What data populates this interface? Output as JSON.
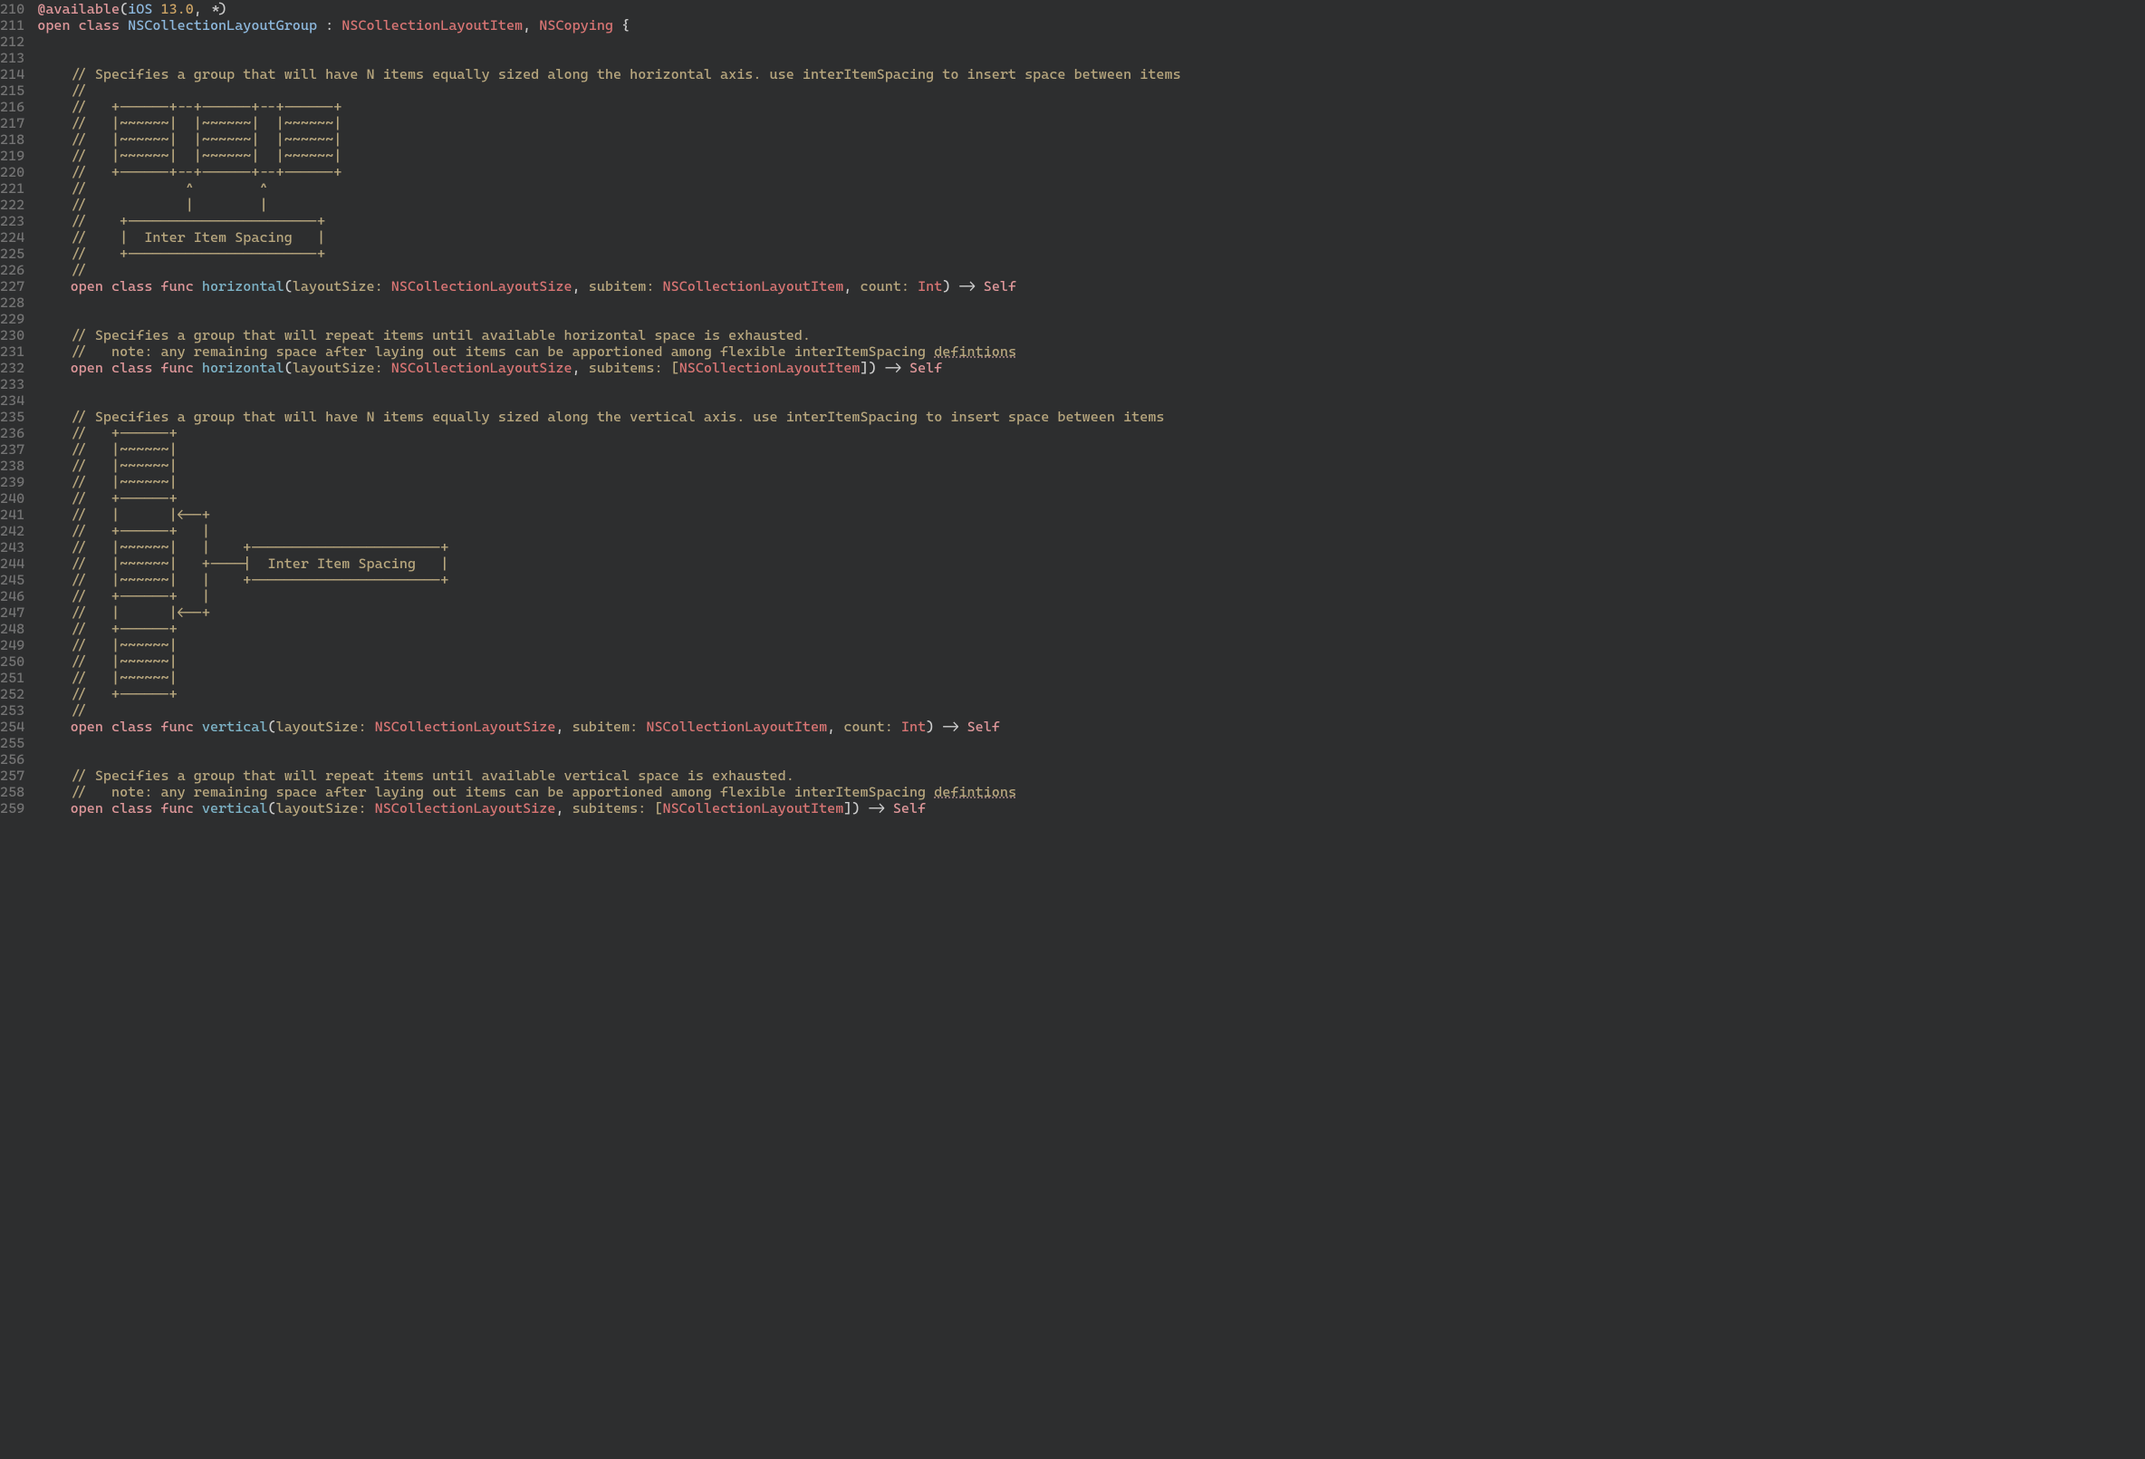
{
  "startLine": 210,
  "lines": [
    {
      "tokens": [
        {
          "t": "@available",
          "c": "kw-attr"
        },
        {
          "t": "(",
          "c": "punct"
        },
        {
          "t": "iOS",
          "c": "type"
        },
        {
          "t": " ",
          "c": "punct"
        },
        {
          "t": "13.0",
          "c": "num"
        },
        {
          "t": ", ",
          "c": "punct"
        },
        {
          "t": "*",
          "c": "star"
        },
        {
          "t": ")",
          "c": "punct"
        }
      ]
    },
    {
      "tokens": [
        {
          "t": "open class ",
          "c": "kw"
        },
        {
          "t": "NSCollectionLayoutGroup",
          "c": "type"
        },
        {
          "t": " : ",
          "c": "punct"
        },
        {
          "t": "NSCollectionLayoutItem",
          "c": "type-red"
        },
        {
          "t": ", ",
          "c": "punct"
        },
        {
          "t": "NSCopying",
          "c": "type-red"
        },
        {
          "t": " {",
          "c": "punct"
        }
      ]
    },
    {
      "tokens": []
    },
    {
      "tokens": [
        {
          "t": "    ",
          "c": ""
        }
      ]
    },
    {
      "tokens": [
        {
          "t": "    // Specifies a group that will have N items equally sized along the horizontal axis. use interItemSpacing to insert space between items",
          "c": "comment"
        }
      ]
    },
    {
      "tokens": [
        {
          "t": "    //",
          "c": "comment"
        }
      ]
    },
    {
      "tokens": [
        {
          "t": "    //   +------+--+------+--+------+",
          "c": "comment"
        }
      ]
    },
    {
      "tokens": [
        {
          "t": "    //   |~~~~~~|  |~~~~~~|  |~~~~~~|",
          "c": "comment"
        }
      ]
    },
    {
      "tokens": [
        {
          "t": "    //   |~~~~~~|  |~~~~~~|  |~~~~~~|",
          "c": "comment"
        }
      ]
    },
    {
      "tokens": [
        {
          "t": "    //   |~~~~~~|  |~~~~~~|  |~~~~~~|",
          "c": "comment"
        }
      ]
    },
    {
      "tokens": [
        {
          "t": "    //   +------+--+------+--+------+",
          "c": "comment"
        }
      ]
    },
    {
      "tokens": [
        {
          "t": "    //            ^        ^",
          "c": "comment"
        }
      ]
    },
    {
      "tokens": [
        {
          "t": "    //            |        |",
          "c": "comment"
        }
      ]
    },
    {
      "tokens": [
        {
          "t": "    //    +-----------------------+",
          "c": "comment"
        }
      ]
    },
    {
      "tokens": [
        {
          "t": "    //    |  Inter Item Spacing   |",
          "c": "comment"
        }
      ]
    },
    {
      "tokens": [
        {
          "t": "    //    +-----------------------+",
          "c": "comment"
        }
      ]
    },
    {
      "tokens": [
        {
          "t": "    //",
          "c": "comment"
        }
      ]
    },
    {
      "tokens": [
        {
          "t": "    ",
          "c": ""
        },
        {
          "t": "open class func ",
          "c": "kw"
        },
        {
          "t": "horizontal",
          "c": "func-name"
        },
        {
          "t": "(",
          "c": "punct"
        },
        {
          "t": "layoutSize: ",
          "c": "param"
        },
        {
          "t": "NSCollectionLayoutSize",
          "c": "type-red"
        },
        {
          "t": ", ",
          "c": "punct"
        },
        {
          "t": "subitem: ",
          "c": "param"
        },
        {
          "t": "NSCollectionLayoutItem",
          "c": "type-red"
        },
        {
          "t": ", ",
          "c": "punct"
        },
        {
          "t": "count: ",
          "c": "param"
        },
        {
          "t": "Int",
          "c": "type-int"
        },
        {
          "t": ") -> ",
          "c": "punct"
        },
        {
          "t": "Self",
          "c": "self-kw"
        }
      ]
    },
    {
      "tokens": []
    },
    {
      "tokens": [
        {
          "t": "    ",
          "c": ""
        }
      ]
    },
    {
      "tokens": [
        {
          "t": "    // Specifies a group that will repeat items until available horizontal space is exhausted.",
          "c": "comment"
        }
      ]
    },
    {
      "tokens": [
        {
          "t": "    //   note: any remaining space after laying out items can be apportioned among flexible interItemSpacing ",
          "c": "comment"
        },
        {
          "t": "defintions",
          "c": "comment underline-wavy"
        }
      ]
    },
    {
      "tokens": [
        {
          "t": "    ",
          "c": ""
        },
        {
          "t": "open class func ",
          "c": "kw"
        },
        {
          "t": "horizontal",
          "c": "func-name"
        },
        {
          "t": "(",
          "c": "punct"
        },
        {
          "t": "layoutSize: ",
          "c": "param"
        },
        {
          "t": "NSCollectionLayoutSize",
          "c": "type-red"
        },
        {
          "t": ", ",
          "c": "punct"
        },
        {
          "t": "subitems: [",
          "c": "param"
        },
        {
          "t": "NSCollectionLayoutItem",
          "c": "type-red"
        },
        {
          "t": "]) -> ",
          "c": "punct"
        },
        {
          "t": "Self",
          "c": "self-kw"
        }
      ]
    },
    {
      "tokens": []
    },
    {
      "tokens": [
        {
          "t": "    ",
          "c": ""
        }
      ]
    },
    {
      "tokens": [
        {
          "t": "    // Specifies a group that will have N items equally sized along the vertical axis. use interItemSpacing to insert space between items",
          "c": "comment"
        }
      ]
    },
    {
      "tokens": [
        {
          "t": "    //   +------+",
          "c": "comment"
        }
      ]
    },
    {
      "tokens": [
        {
          "t": "    //   |~~~~~~|",
          "c": "comment"
        }
      ]
    },
    {
      "tokens": [
        {
          "t": "    //   |~~~~~~|",
          "c": "comment"
        }
      ]
    },
    {
      "tokens": [
        {
          "t": "    //   |~~~~~~|",
          "c": "comment"
        }
      ]
    },
    {
      "tokens": [
        {
          "t": "    //   +------+",
          "c": "comment"
        }
      ]
    },
    {
      "tokens": [
        {
          "t": "    //   |      |<--+",
          "c": "comment"
        }
      ]
    },
    {
      "tokens": [
        {
          "t": "    //   +------+   |",
          "c": "comment"
        }
      ]
    },
    {
      "tokens": [
        {
          "t": "    //   |~~~~~~|   |    +-----------------------+",
          "c": "comment"
        }
      ]
    },
    {
      "tokens": [
        {
          "t": "    //   |~~~~~~|   +----|  Inter Item Spacing   |",
          "c": "comment"
        }
      ]
    },
    {
      "tokens": [
        {
          "t": "    //   |~~~~~~|   |    +-----------------------+",
          "c": "comment"
        }
      ]
    },
    {
      "tokens": [
        {
          "t": "    //   +------+   |",
          "c": "comment"
        }
      ]
    },
    {
      "tokens": [
        {
          "t": "    //   |      |<--+",
          "c": "comment"
        }
      ]
    },
    {
      "tokens": [
        {
          "t": "    //   +------+",
          "c": "comment"
        }
      ]
    },
    {
      "tokens": [
        {
          "t": "    //   |~~~~~~|",
          "c": "comment"
        }
      ]
    },
    {
      "tokens": [
        {
          "t": "    //   |~~~~~~|",
          "c": "comment"
        }
      ]
    },
    {
      "tokens": [
        {
          "t": "    //   |~~~~~~|",
          "c": "comment"
        }
      ]
    },
    {
      "tokens": [
        {
          "t": "    //   +------+",
          "c": "comment"
        }
      ]
    },
    {
      "tokens": [
        {
          "t": "    //",
          "c": "comment"
        }
      ]
    },
    {
      "tokens": [
        {
          "t": "    ",
          "c": ""
        },
        {
          "t": "open class func ",
          "c": "kw"
        },
        {
          "t": "vertical",
          "c": "func-name"
        },
        {
          "t": "(",
          "c": "punct"
        },
        {
          "t": "layoutSize: ",
          "c": "param"
        },
        {
          "t": "NSCollectionLayoutSize",
          "c": "type-red"
        },
        {
          "t": ", ",
          "c": "punct"
        },
        {
          "t": "subitem: ",
          "c": "param"
        },
        {
          "t": "NSCollectionLayoutItem",
          "c": "type-red"
        },
        {
          "t": ", ",
          "c": "punct"
        },
        {
          "t": "count: ",
          "c": "param"
        },
        {
          "t": "Int",
          "c": "type-int"
        },
        {
          "t": ") -> ",
          "c": "punct"
        },
        {
          "t": "Self",
          "c": "self-kw"
        }
      ]
    },
    {
      "tokens": []
    },
    {
      "tokens": [
        {
          "t": "    ",
          "c": ""
        }
      ]
    },
    {
      "tokens": [
        {
          "t": "    // Specifies a group that will repeat items until available vertical space is exhausted.",
          "c": "comment"
        }
      ]
    },
    {
      "tokens": [
        {
          "t": "    //   note: any remaining space after laying out items can be apportioned among flexible interItemSpacing ",
          "c": "comment"
        },
        {
          "t": "defintions",
          "c": "comment underline-wavy"
        }
      ]
    },
    {
      "tokens": [
        {
          "t": "    ",
          "c": ""
        },
        {
          "t": "open class func ",
          "c": "kw"
        },
        {
          "t": "vertical",
          "c": "func-name"
        },
        {
          "t": "(",
          "c": "punct"
        },
        {
          "t": "layoutSize: ",
          "c": "param"
        },
        {
          "t": "NSCollectionLayoutSize",
          "c": "type-red"
        },
        {
          "t": ", ",
          "c": "punct"
        },
        {
          "t": "subitems: [",
          "c": "param"
        },
        {
          "t": "NSCollectionLayoutItem",
          "c": "type-red"
        },
        {
          "t": "]) -> ",
          "c": "punct"
        },
        {
          "t": "Self",
          "c": "self-kw"
        }
      ]
    }
  ]
}
